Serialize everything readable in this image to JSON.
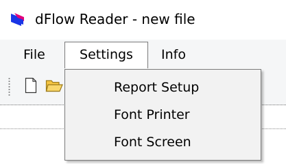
{
  "window": {
    "title": "dFlow Reader - new file",
    "icon": "app-logo-icon"
  },
  "menubar": {
    "items": [
      {
        "label": "File"
      },
      {
        "label": "Settings",
        "state": "open"
      },
      {
        "label": "Info"
      }
    ]
  },
  "toolbar": {
    "buttons": [
      {
        "icon": "new-file-icon"
      },
      {
        "icon": "open-folder-icon"
      }
    ]
  },
  "settings_menu": {
    "items": [
      {
        "label": "Report Setup"
      },
      {
        "label": "Font Printer"
      },
      {
        "label": "Font Screen"
      }
    ]
  },
  "colors": {
    "menubar_bg": "#f5f6f7",
    "dropdown_bg": "#f2f2f2",
    "border": "#7a7a7a",
    "icon_blue": "#1a35e6",
    "icon_magenta": "#e0007a",
    "folder_yellow": "#f5c542"
  }
}
